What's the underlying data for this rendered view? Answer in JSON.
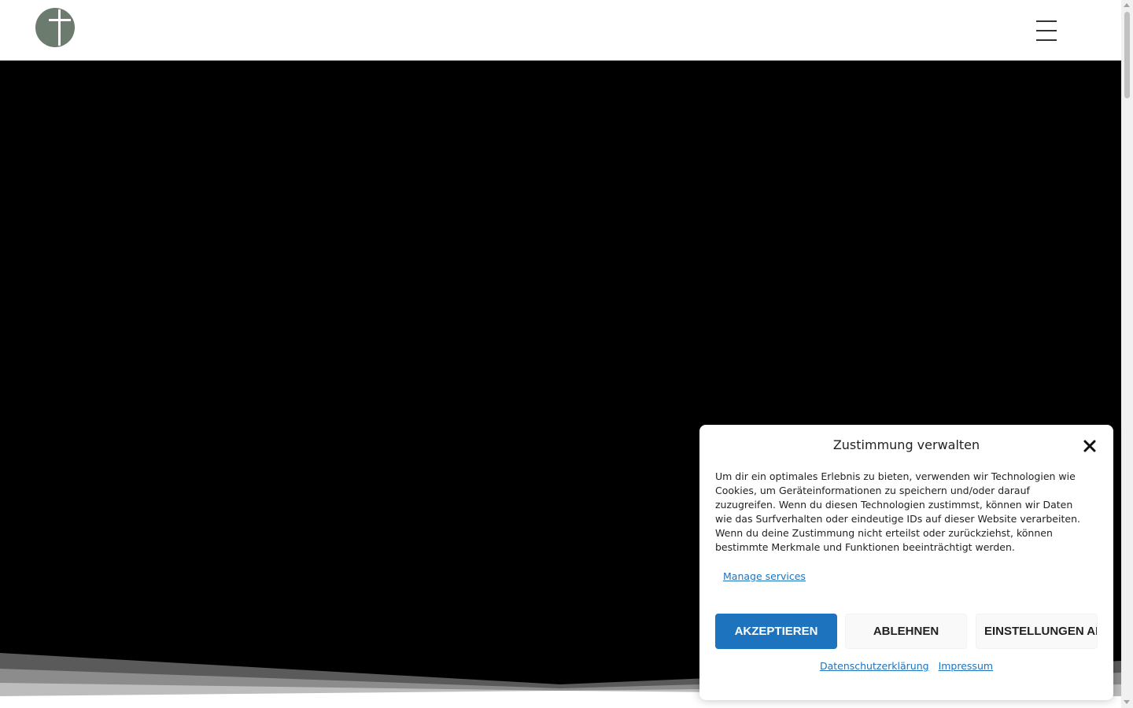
{
  "header": {
    "logo_alt": "Logo",
    "logo_color": "#6b7b6d",
    "menu_icon": "hamburger-icon"
  },
  "hero": {
    "background": "#000000"
  },
  "cookie_modal": {
    "title": "Zustimmung verwalten",
    "close_icon": "close-icon",
    "body": "Um dir ein optimales Erlebnis zu bieten, verwenden wir Technologien wie Cookies, um Geräteinformationen zu speichern und/oder darauf zuzugreifen. Wenn du diesen Technologien zustimmst, können wir Daten wie das Surfverhalten oder eindeutige IDs auf dieser Website verarbeiten. Wenn du deine Zustimmung nicht erteilst oder zurückziehst, können bestimmte Merkmale und Funktionen beeinträchtigt werden.",
    "manage_services": "Manage services",
    "accept_label": "AKZEPTIEREN",
    "deny_label": "ABLEHNEN",
    "settings_label": "EINSTELLUNGEN ANSEHEN",
    "privacy_link": "Datenschutzerklärung",
    "imprint_link": "Impressum",
    "accent_color": "#1e73be"
  }
}
